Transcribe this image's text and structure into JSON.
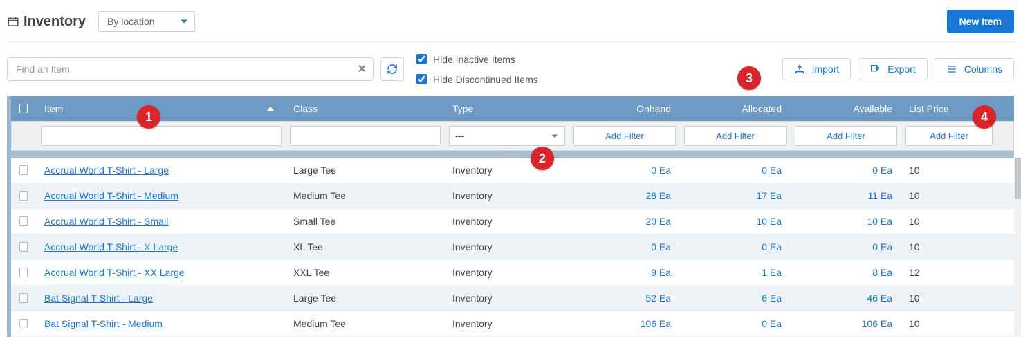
{
  "header": {
    "title": "Inventory",
    "view_dropdown": "By location",
    "new_item_label": "New Item"
  },
  "toolbar": {
    "search_placeholder": "Find an Item",
    "hide_inactive_label": "Hide Inactive Items",
    "hide_inactive_checked": true,
    "hide_discontinued_label": "Hide Discontinued Items",
    "hide_discontinued_checked": true,
    "import_label": "Import",
    "export_label": "Export",
    "columns_label": "Columns"
  },
  "columns": {
    "item": "Item",
    "class": "Class",
    "type": "Type",
    "onhand": "Onhand",
    "allocated": "Allocated",
    "available": "Available",
    "list_price": "List Price"
  },
  "filters": {
    "type_placeholder": "---",
    "add_filter_label": "Add Filter"
  },
  "rows": [
    {
      "item": "Accrual World T-Shirt - Large",
      "class": "Large Tee",
      "type": "Inventory",
      "onhand": "0 Ea",
      "allocated": "0 Ea",
      "available": "0 Ea",
      "list_price": "10"
    },
    {
      "item": "Accrual World T-Shirt - Medium",
      "class": "Medium Tee",
      "type": "Inventory",
      "onhand": "28 Ea",
      "allocated": "17 Ea",
      "available": "11 Ea",
      "list_price": "10"
    },
    {
      "item": "Accrual World T-Shirt - Small",
      "class": "Small Tee",
      "type": "Inventory",
      "onhand": "20 Ea",
      "allocated": "10 Ea",
      "available": "10 Ea",
      "list_price": "10"
    },
    {
      "item": "Accrual World T-Shirt - X Large",
      "class": "XL Tee",
      "type": "Inventory",
      "onhand": "0 Ea",
      "allocated": "0 Ea",
      "available": "0 Ea",
      "list_price": "10"
    },
    {
      "item": "Accrual World T-Shirt - XX Large",
      "class": "XXL Tee",
      "type": "Inventory",
      "onhand": "9 Ea",
      "allocated": "1 Ea",
      "available": "8 Ea",
      "list_price": "12"
    },
    {
      "item": "Bat Signal T-Shirt - Large",
      "class": "Large Tee",
      "type": "Inventory",
      "onhand": "52 Ea",
      "allocated": "6 Ea",
      "available": "46 Ea",
      "list_price": "10"
    },
    {
      "item": "Bat Signal T-Shirt - Medium",
      "class": "Medium Tee",
      "type": "Inventory",
      "onhand": "106 Ea",
      "allocated": "0 Ea",
      "available": "106 Ea",
      "list_price": "10"
    }
  ],
  "callouts": {
    "c1": "1",
    "c2": "2",
    "c3": "3",
    "c4": "4"
  }
}
